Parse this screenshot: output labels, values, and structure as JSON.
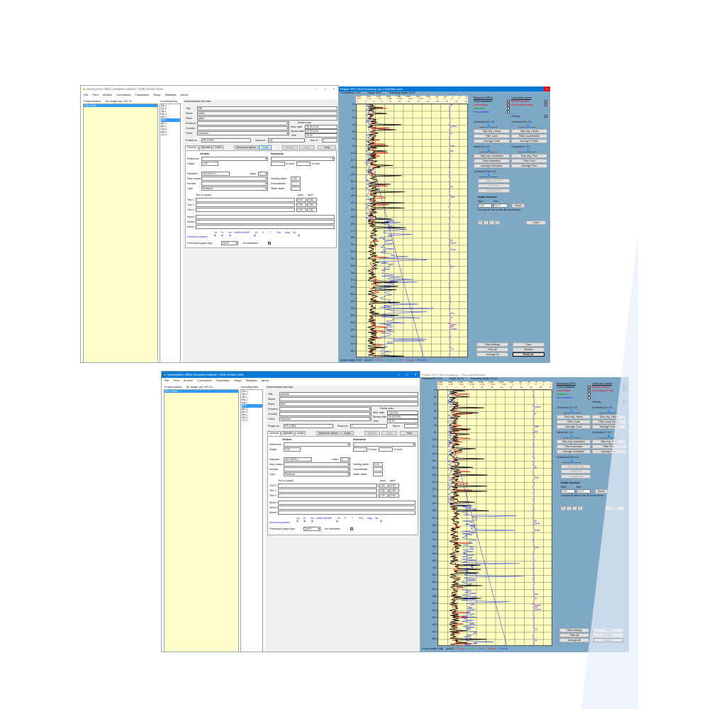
{
  "app": {
    "title": "GeoExplorer Office (Geopoint edition) / VSM   Archive 2018",
    "menu": [
      "File",
      "Print",
      "Archive",
      "Commands",
      "Translation",
      "Setup",
      "Statistics",
      "About"
    ],
    "project_folders_label": "Project folders",
    "tot_length_label": "Tot. length (m): 457.21",
    "selected_project": "PR-17804",
    "sounding_files_label": "Sounding files:",
    "admin_label": "Administrative test data"
  },
  "top": {
    "sounding_files": [
      "SA-1",
      "SA-2",
      "JB-1",
      "SB-1",
      "AR-1",
      "AK-1",
      "AA-1",
      "SA-3",
      "AA-2",
      "CC-1"
    ],
    "selected_sounding": "AA-1",
    "fields": {
      "title": "title",
      "street": "street",
      "place": "place",
      "province": "",
      "country": "",
      "client": "Unknown",
      "postal_code": "",
      "mod_date": "28.08.2018",
      "survey_date": "29.03.2018",
      "time": "09:30",
      "project_no": "PR-17804",
      "sound_no": "AA",
      "sub_nr": "2"
    },
    "graph_title": "Project: PR-17804  Sounding: AA-2   Test title place",
    "ground_level": "Groundlevel: 0.00",
    "depth": "Depth: 54.37",
    "sounding_length": "Sounding length: 54.37",
    "cursor_status": [
      "Cursor depth: 0.00",
      "Qc=0.0",
      "Fr=0.0",
      "Inc=0.0",
      "P=0.0",
      "Fs=0.0",
      "Pr=0.00"
    ],
    "depth_start": "0.00",
    "depth_end": "54.37"
  },
  "bottom": {
    "sounding_files": [
      "SA-1",
      "SA-2",
      "JB-1",
      "SB-1",
      "AA-1",
      "AR-2",
      "AK-2",
      "SB-1",
      "SB-2",
      "CC-1"
    ],
    "selected_sounding": "JB-2",
    "fields": {
      "title": "test title",
      "street": "",
      "place": "Bern",
      "province": "",
      "country": "",
      "client": "Unknown",
      "postal_code": "",
      "mod_date": "3.8.2018",
      "survey_date": "18.04.2018",
      "time": "10:40",
      "project_no": "PR-17804",
      "sound_no": "1",
      "sub_nr": ""
    },
    "graph_title": "Project: PR-17804  Sounding: 1   Test standard Bern",
    "ground_level": "Groundlevel: 0.00",
    "depth": "Depth: 54.14",
    "sounding_length": "Sounding length: 54.14",
    "cursor_status": [
      "Cursor depth: 0.58",
      "Qc=0.0",
      "Fr=0.0",
      "Inc=0.0",
      "P=0.4",
      "Fs=0.0",
      "Pr=0.00"
    ],
    "depth_start": "0.00",
    "depth_end": "54.14"
  },
  "form_labels": {
    "title": "Title",
    "street": "Street",
    "place": "Place",
    "province": "Province",
    "country": "Country",
    "client": "Client",
    "postal_code": "Postal code",
    "mod_date": "Mod. date",
    "survey_date": "Survey date",
    "time": "Time",
    "project_no": "Project no",
    "sound_no": "Sound.nr",
    "sub_nr": "Sub nr",
    "tabs": [
      "General",
      "Specific",
      "Cone"
    ],
    "measured_values": "Measured Values",
    "graph": "Graph",
    "restore": "Restore",
    "copy": "Copy",
    "help": "Help",
    "vertical": "Vertical",
    "horizontal": "Horizontal",
    "reference": "Reference",
    "height": "Height",
    "height_value": "0.00",
    "xcoord": "XCoord",
    "ycoord": "YCoord",
    "standard": "Standard",
    "standard_value": "ISO 22476-1",
    "class": "Class",
    "class_value": "2",
    "stop_reason": "Stop reason",
    "surface": "Surface",
    "type": "Type",
    "type_value": "Electrical",
    "starting_depth": "Starting depth",
    "starting_depth_value": "0.00",
    "groundwater": "Groundwater",
    "water_depth": "Water depth",
    "text_on_graph": "Text on graph",
    "text1": "Text 1",
    "text2": "Text 2",
    "text3": "Text 3",
    "pos_x": "posX",
    "pos_y": "posY",
    "text_pos": [
      [
        "0.50",
        "0.80"
      ],
      [
        "0.50",
        "1.80"
      ],
      [
        "1.00",
        "2.80"
      ]
    ],
    "memo1": "Memo 1",
    "memo2": "Memo 2",
    "memo3": "Memo 3",
    "measured_params": "Measured params",
    "param_names": [
      "Qc",
      "Fr",
      "Inc",
      "IncMS",
      "IncEW",
      "P",
      "Ex",
      "S",
      "T",
      "Prot",
      "Mag",
      "Tqt"
    ],
    "print_graph_type": "Print/report graph type",
    "graph_type_value": "Qc+Fr",
    "no_inclination": "No Inclination"
  },
  "scale_rows": [
    [
      "0.18",
      "0.00",
      "0.18",
      "0.28",
      "0.38",
      "0.50",
      "0.60",
      "0.60",
      "10",
      "15",
      "0",
      "5",
      "0"
    ],
    [
      "0.00",
      "0.10",
      "0.20",
      "0.30",
      "0.40",
      "0.50",
      "0.60",
      "0",
      "5",
      "4",
      "2",
      "1",
      "0"
    ],
    [
      "0",
      "2",
      "4",
      "6",
      "8",
      "10",
      "12",
      "14",
      "16",
      "18",
      "20",
      "22",
      "24"
    ]
  ],
  "right_panel": {
    "measured_header": "Measured (MPa)",
    "calculated_header": "Calculated values",
    "measured_items": [
      "Cone resistance",
      "Local friction",
      "Inclination",
      "Pore pressure"
    ],
    "calculated_items": [
      "Friction number",
      "Pore pressure ratio"
    ],
    "overlay": "Overlay",
    "correction_qc": "Correction Qc: 0.0",
    "correction_fs": "Correction Fs: 0.0",
    "skip_neg_values": "Skip neg. values",
    "filter_cone": "Filter Cone",
    "filter_local_friction": "Filter Local friction",
    "average_cone": "Average Cone",
    "average_friction": "Average Friction",
    "factor_inc": "Factor Inc: 1.0",
    "correction_p": "Correction P: 0.0",
    "skip_neg_inclination": "Skip neg. Inclination",
    "skip_neg_pore": "Skip neg. Pore",
    "filter_inclination": "Filter Inclination",
    "filter_pore": "Filter Pore",
    "average_inclination": "Average Inclination",
    "average_pore": "Average Pore",
    "correction_ftot": "Correction Ftot: 0.0",
    "skip_neg_ftot": "Skip neg. Ftot",
    "filter_ftot": "Filter Ftot",
    "average_ftot": "Average Ftot",
    "depth_selection": "Depth selection",
    "start": "Start",
    "end": "End",
    "reset": "Reset",
    "select_hint": "You may set interval with left mouse button",
    "close": "Close",
    "filter_settings": "Filter settings",
    "save": "Save",
    "filter_all": "Filter All",
    "restore": "Restore",
    "average_all": "Average All",
    "read_me": "Read me"
  },
  "colors": {
    "titlebar_active": "#0078d7",
    "titlebar_inactive": "#ffffff",
    "graph_bg": "#7fa8c7",
    "plot_bg": "#ffffc0",
    "folder_bg": "#ffffcc",
    "cone": "#000000",
    "friction": "#e00000",
    "inclination": "#8a2be2",
    "pore": "#2233dd"
  }
}
